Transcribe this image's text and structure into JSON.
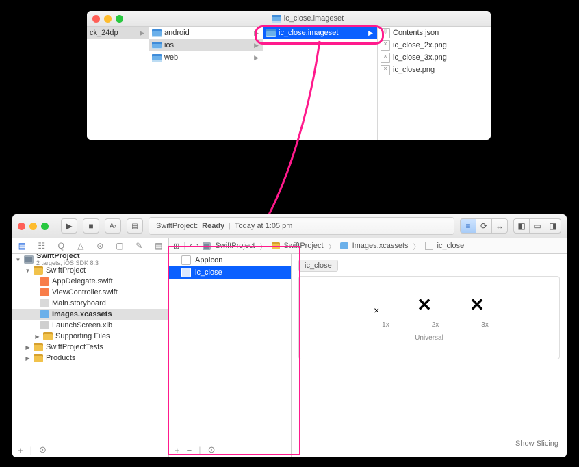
{
  "finder": {
    "title": "ic_close.imageset",
    "col0_item": "ck_24dp",
    "col1": [
      "android",
      "ios",
      "web"
    ],
    "col1_selected_index": 1,
    "col2": [
      "ic_close.imageset"
    ],
    "col3": [
      "Contents.json",
      "ic_close_2x.png",
      "ic_close_3x.png",
      "ic_close.png"
    ]
  },
  "xcode": {
    "toolbar": {
      "run_glyph": "▶",
      "stop_glyph": "■",
      "status_project": "SwiftProject:",
      "status_state": "Ready",
      "status_time": "Today at 1:05 pm",
      "view_glyph1": "≡",
      "view_glyph2": "⟳",
      "view_glyph3": "↔",
      "pane_glyphs": [
        "◧",
        "▭",
        "◨"
      ]
    },
    "jumpbar": {
      "parts": [
        "SwiftProject",
        "SwiftProject",
        "Images.xcassets",
        "ic_close"
      ],
      "jb_glyph1": "⊞",
      "jb_glyph2": "‹",
      "jb_glyph3": "›"
    },
    "nav_tabs_glyphs": [
      "▤",
      "☷",
      "Q",
      "△",
      "⊙",
      "▢",
      "✎",
      "▤"
    ],
    "project_tree": {
      "root": "SwiftProject",
      "root_sub": "2 targets, iOS SDK 8.3",
      "group1": "SwiftProject",
      "files1": [
        "AppDelegate.swift",
        "ViewController.swift",
        "Main.storyboard",
        "Images.xcassets",
        "LaunchScreen.xib"
      ],
      "group1b": "Supporting Files",
      "group2": "SwiftProjectTests",
      "group3": "Products",
      "selected": "Images.xcassets"
    },
    "nav_footer": {
      "plus": "+",
      "filter": "⊙"
    },
    "asset_list": {
      "items": [
        "AppIcon",
        "ic_close"
      ],
      "selected_index": 1,
      "footer_plus": "+",
      "footer_minus": "−",
      "footer_filter": "⊙"
    },
    "preview": {
      "title": "ic_close",
      "scales": [
        "1x",
        "2x",
        "3x"
      ],
      "universal": "Universal",
      "show_slicing": "Show Slicing",
      "x_small": "×",
      "x_med": "✕",
      "x_big": "✕"
    }
  }
}
